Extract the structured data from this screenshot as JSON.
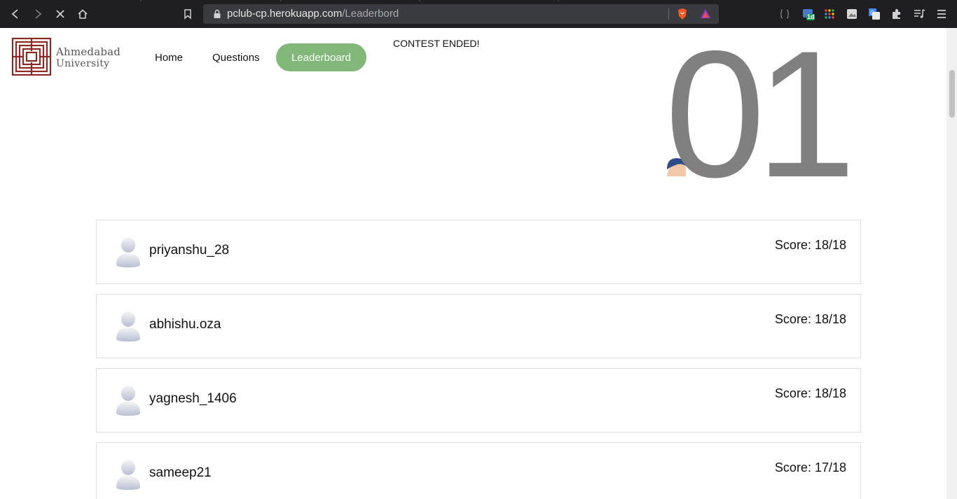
{
  "browser": {
    "url_host": "pclub-cp.herokuapp.com",
    "url_path": "/Leaderbord",
    "extension_badge": "1d"
  },
  "header": {
    "logo_line1": "Ahmedabad",
    "logo_line2": "University",
    "nav": {
      "home": "Home",
      "questions": "Questions",
      "leaderboard": "Leaderboard"
    },
    "contest_status": "CONTEST ENDED!"
  },
  "timer_display": "01",
  "colors": {
    "accent": "#82b77a",
    "logo": "#8b2a24",
    "timer": "#808080"
  },
  "leaderboard": [
    {
      "name": "priyanshu_28",
      "score": "Score: 18/18"
    },
    {
      "name": "abhishu.oza",
      "score": "Score: 18/18"
    },
    {
      "name": "yagnesh_1406",
      "score": "Score: 18/18"
    },
    {
      "name": "sameep21",
      "score": "Score: 17/18"
    }
  ]
}
